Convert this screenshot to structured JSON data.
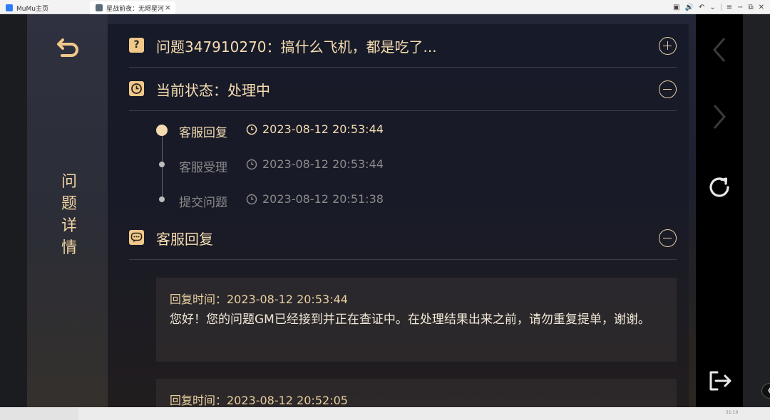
{
  "window": {
    "tabs": [
      {
        "label": "MuMu主页"
      },
      {
        "label": "星战前夜：无烬星河"
      }
    ],
    "tab_close": "×",
    "controls": [
      "▣",
      "🔊",
      "↶",
      "⌄",
      "≡",
      "−",
      "⧉",
      "✕"
    ]
  },
  "sidebar": {
    "title_chars": [
      "问",
      "题",
      "详",
      "情"
    ]
  },
  "question": {
    "icon_text": "?",
    "title": "问题347910270：搞什么飞机，都是吃了..."
  },
  "status": {
    "title": "当前状态：处理中",
    "timeline": [
      {
        "label": "客服回复",
        "time": "2023-08-12 20:53:44"
      },
      {
        "label": "客服受理",
        "time": "2023-08-12 20:53:44"
      },
      {
        "label": "提交问题",
        "time": "2023-08-12 20:51:38"
      }
    ]
  },
  "replies_section": {
    "title": "客服回复",
    "replies": [
      {
        "time": "回复时间：2023-08-12 20:53:44",
        "body": "您好！您的问题GM已经接到并正在查证中。在处理结果出来之前，请勿重复提单，谢谢。"
      },
      {
        "time": "回复时间：2023-08-12 20:52:05",
        "body": ""
      }
    ]
  },
  "bottom_status": "21:10",
  "colors": {
    "accent": "#f0c88a",
    "text_active": "#f5dcb0",
    "text_muted": "#8a8a8a"
  }
}
